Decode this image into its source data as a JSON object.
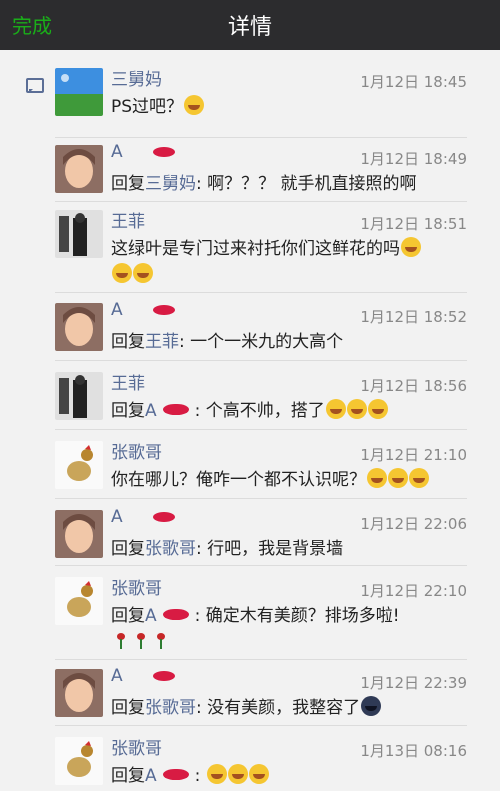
{
  "header": {
    "done_label": "完成",
    "title": "详情"
  },
  "colors": {
    "header_bg": "#2c2c2e",
    "done": "#1aad19",
    "name": "#576b95",
    "text": "#222222",
    "time": "#888888"
  },
  "comments": [
    {
      "name": "三舅妈",
      "time": "1月12日 18:45",
      "text": "PS过吧？",
      "emoji_after": [
        "grin-sweat-emoji"
      ]
    },
    {
      "name": "A",
      "time": "1月12日 18:49",
      "reply_prefix": "回复",
      "reply_to": "三舅妈",
      "text": ": 啊？？？ 就手机直接照的啊"
    },
    {
      "name": "王菲",
      "time": "1月12日 18:51",
      "text": "这绿叶是专门过来衬托你们这鲜花的吗",
      "emoji_after": [
        "rolling-laugh-emoji",
        "rolling-laugh-emoji",
        "rolling-laugh-emoji"
      ]
    },
    {
      "name": "A",
      "time": "1月12日 18:52",
      "reply_prefix": "回复",
      "reply_to": "王菲",
      "text": ": 一个一米九的大高个"
    },
    {
      "name": "王菲",
      "time": "1月12日 18:56",
      "reply_prefix": "回复",
      "reply_to": "A",
      "text": ": 个高不帅，搭了",
      "emoji_after": [
        "tears-of-joy-emoji",
        "tears-of-joy-emoji",
        "tears-of-joy-emoji"
      ]
    },
    {
      "name": "张歌哥",
      "time": "1月12日 21:10",
      "text": "你在哪儿？俺咋一个都不认识呢？",
      "emoji_after": [
        "grin-sweat-emoji",
        "grin-sweat-emoji",
        "grin-sweat-emoji"
      ]
    },
    {
      "name": "A",
      "time": "1月12日 22:06",
      "reply_prefix": "回复",
      "reply_to": "张歌哥",
      "text": ": 行吧，我是背景墙"
    },
    {
      "name": "张歌哥",
      "time": "1月12日 22:10",
      "reply_prefix": "回复",
      "reply_to": "A",
      "text": ": 确定木有美颜？排场多啦!",
      "emoji_after": [
        "rose-emoji",
        "rose-emoji",
        "rose-emoji"
      ]
    },
    {
      "name": "A",
      "time": "1月12日 22:39",
      "reply_prefix": "回复",
      "reply_to": "张歌哥",
      "text": ": 没有美颜，我整容了",
      "emoji_after": [
        "new-moon-face-emoji"
      ]
    },
    {
      "name": "张歌哥",
      "time": "1月13日 08:16",
      "reply_prefix": "回复",
      "reply_to": "A",
      "text": ": ",
      "emoji_after": [
        "smirk-emoji",
        "smirk-emoji",
        "smirk-emoji"
      ]
    }
  ]
}
